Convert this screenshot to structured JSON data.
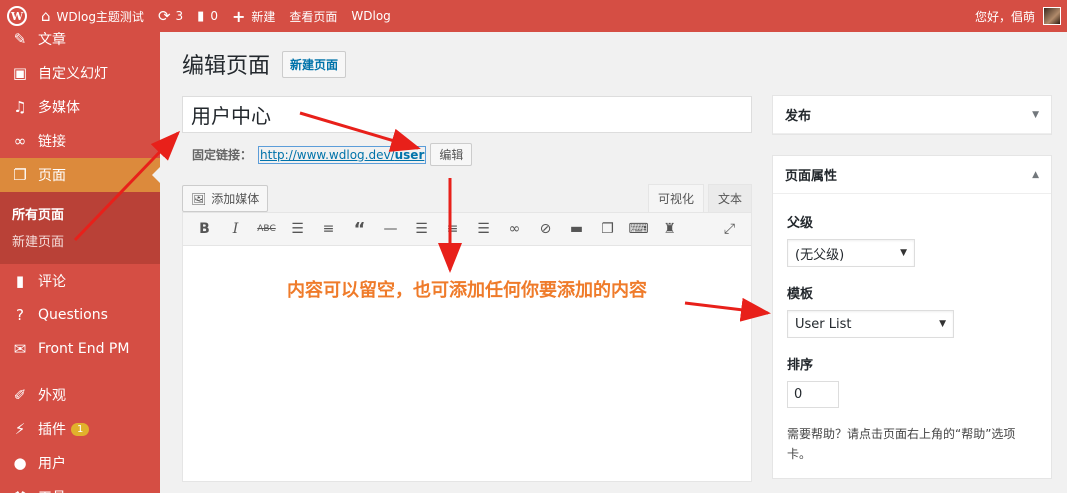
{
  "adminbar": {
    "site_name": "WDlog主题测试",
    "updates_count": "3",
    "comments_count": "0",
    "new_label": "新建",
    "view_page_label": "查看页面",
    "wdlog_label": "WDlog",
    "greeting": "您好，倡萌"
  },
  "sidebar": {
    "items": [
      {
        "label": "文章",
        "icon": "pin-icon"
      },
      {
        "label": "自定义幻灯",
        "icon": "slides-icon"
      },
      {
        "label": "多媒体",
        "icon": "media-icon"
      },
      {
        "label": "链接",
        "icon": "link-icon"
      },
      {
        "label": "页面",
        "icon": "page-icon"
      },
      {
        "label": "评论",
        "icon": "comment-icon"
      },
      {
        "label": "Questions",
        "icon": "question-icon"
      },
      {
        "label": "Front End PM",
        "icon": "mail-icon"
      },
      {
        "label": "外观",
        "icon": "brush-icon"
      },
      {
        "label": "插件",
        "icon": "plugin-icon"
      },
      {
        "label": "用户",
        "icon": "user-icon"
      },
      {
        "label": "工具",
        "icon": "tool-icon"
      }
    ],
    "submenu": [
      "所有页面",
      "新建页面"
    ],
    "plugins_badge": "1"
  },
  "main": {
    "title": "编辑页面",
    "add_new": "新建页面",
    "post_title": "用户中心",
    "permalink_label": "固定链接：",
    "permalink_base": "http://www.wdlog.dev/",
    "permalink_slug": "user",
    "edit_label": "编辑",
    "add_media": "添加媒体",
    "tab_visual": "可视化",
    "tab_text": "文本",
    "annotation": "内容可以留空，也可添加任何你要添加的内容"
  },
  "side": {
    "publish_title": "发布",
    "attributes_title": "页面属性",
    "parent_label": "父级",
    "parent_value": "(无父级)",
    "template_label": "模板",
    "template_value": "User List",
    "order_label": "排序",
    "order_value": "0",
    "help_text": "需要帮助？请点击页面右上角的“帮助”选项卡。"
  },
  "colors": {
    "admin_red": "#d54e44",
    "current_orange": "#dc8a3c",
    "annotation_orange": "#ef7b2a",
    "arrow_red": "#e8201a",
    "link_blue": "#0073aa"
  }
}
